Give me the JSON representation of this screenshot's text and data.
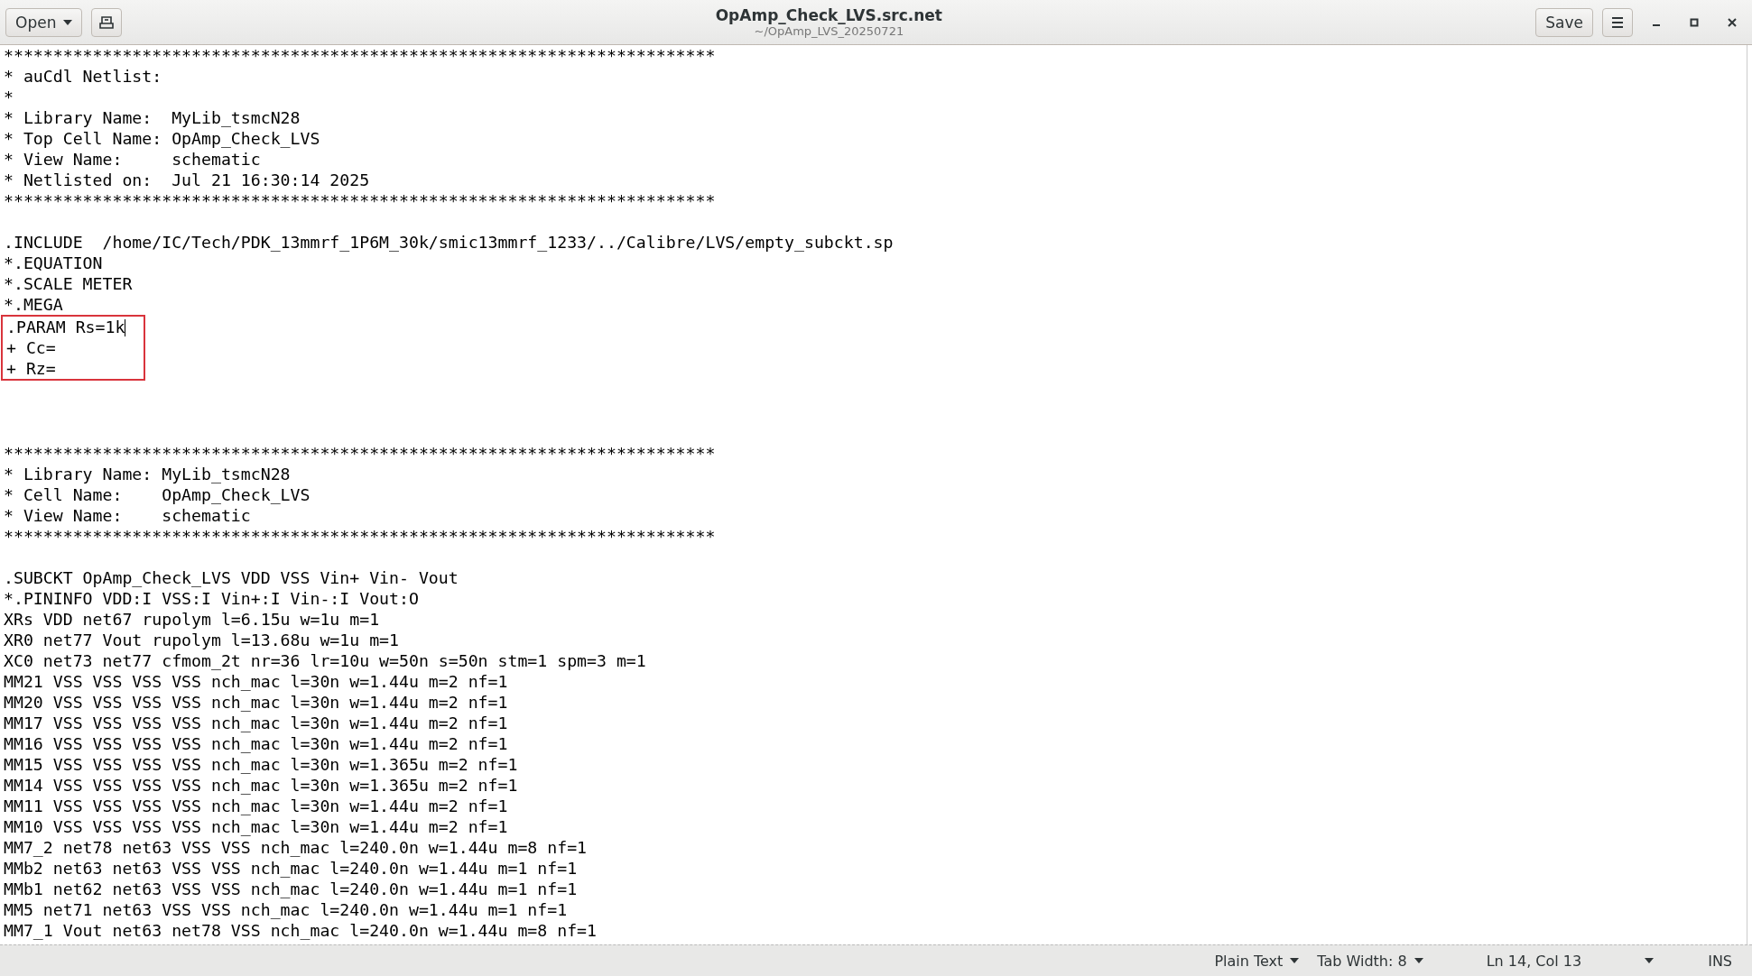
{
  "window": {
    "title": "OpAmp_Check_LVS.src.net",
    "subtitle": "~/OpAmp_LVS_20250721"
  },
  "header_bar": {
    "open_button": "Open",
    "save_button": "Save"
  },
  "editor": {
    "blocks": [
      {
        "kind": "plain",
        "lines": [
          {
            "kind": "code",
            "text": "************************************************************************"
          },
          {
            "kind": "code",
            "text": "* auCdl Netlist:"
          },
          {
            "kind": "code",
            "text": "*"
          },
          {
            "kind": "code",
            "text": "* Library Name:  MyLib_tsmcN28"
          },
          {
            "kind": "code",
            "text": "* Top Cell Name: OpAmp_Check_LVS"
          },
          {
            "kind": "code",
            "text": "* View Name:     schematic"
          },
          {
            "kind": "code",
            "text": "* Netlisted on:  Jul 21 16:30:14 2025"
          },
          {
            "kind": "code",
            "text": "************************************************************************"
          },
          {
            "kind": "blank"
          },
          {
            "kind": "code",
            "text": ".INCLUDE  /home/IC/Tech/PDK_13mmrf_1P6M_30k/smic13mmrf_1233/../Calibre/LVS/empty_subckt.sp"
          },
          {
            "kind": "code",
            "text": "*.EQUATION"
          },
          {
            "kind": "code",
            "text": "*.SCALE METER"
          },
          {
            "kind": "code",
            "text": "*.MEGA"
          }
        ]
      },
      {
        "kind": "marked",
        "lines": [
          {
            "kind": "code",
            "text": ".PARAM Rs=1k",
            "cursor": true
          },
          {
            "kind": "code",
            "text": "+ Cc=",
            "cursor": false
          },
          {
            "kind": "code",
            "text": "+ Rz=",
            "cursor": false
          }
        ]
      },
      {
        "kind": "plain",
        "lines": [
          {
            "kind": "blank"
          },
          {
            "kind": "blank"
          },
          {
            "kind": "blank"
          },
          {
            "kind": "code",
            "text": "************************************************************************"
          },
          {
            "kind": "code",
            "text": "* Library Name: MyLib_tsmcN28"
          },
          {
            "kind": "code",
            "text": "* Cell Name:    OpAmp_Check_LVS"
          },
          {
            "kind": "code",
            "text": "* View Name:    schematic"
          },
          {
            "kind": "code",
            "text": "************************************************************************"
          },
          {
            "kind": "blank"
          },
          {
            "kind": "code",
            "text": ".SUBCKT OpAmp_Check_LVS VDD VSS Vin+ Vin- Vout"
          },
          {
            "kind": "code",
            "text": "*.PININFO VDD:I VSS:I Vin+:I Vin-:I Vout:O"
          },
          {
            "kind": "code",
            "text": "XRs VDD net67 rupolym l=6.15u w=1u m=1"
          },
          {
            "kind": "code",
            "text": "XR0 net77 Vout rupolym l=13.68u w=1u m=1"
          },
          {
            "kind": "code",
            "text": "XC0 net73 net77 cfmom_2t nr=36 lr=10u w=50n s=50n stm=1 spm=3 m=1"
          },
          {
            "kind": "code",
            "text": "MM21 VSS VSS VSS VSS nch_mac l=30n w=1.44u m=2 nf=1"
          },
          {
            "kind": "code",
            "text": "MM20 VSS VSS VSS VSS nch_mac l=30n w=1.44u m=2 nf=1"
          },
          {
            "kind": "code",
            "text": "MM17 VSS VSS VSS VSS nch_mac l=30n w=1.44u m=2 nf=1"
          },
          {
            "kind": "code",
            "text": "MM16 VSS VSS VSS VSS nch_mac l=30n w=1.44u m=2 nf=1"
          },
          {
            "kind": "code",
            "text": "MM15 VSS VSS VSS VSS nch_mac l=30n w=1.365u m=2 nf=1"
          },
          {
            "kind": "code",
            "text": "MM14 VSS VSS VSS VSS nch_mac l=30n w=1.365u m=2 nf=1"
          },
          {
            "kind": "code",
            "text": "MM11 VSS VSS VSS VSS nch_mac l=30n w=1.44u m=2 nf=1"
          },
          {
            "kind": "code",
            "text": "MM10 VSS VSS VSS VSS nch_mac l=30n w=1.44u m=2 nf=1"
          },
          {
            "kind": "code",
            "text": "MM7_2 net78 net63 VSS VSS nch_mac l=240.0n w=1.44u m=8 nf=1"
          },
          {
            "kind": "code",
            "text": "MMb2 net63 net63 VSS VSS nch_mac l=240.0n w=1.44u m=1 nf=1"
          },
          {
            "kind": "code",
            "text": "MMb1 net62 net63 VSS VSS nch_mac l=240.0n w=1.44u m=1 nf=1"
          },
          {
            "kind": "code",
            "text": "MM5 net71 net63 VSS VSS nch_mac l=240.0n w=1.44u m=1 nf=1"
          },
          {
            "kind": "code",
            "text": "MM7_1 Vout net63 net78 VSS nch_mac l=240.0n w=1.44u m=8 nf=1"
          }
        ]
      }
    ]
  },
  "status_bar": {
    "language": "Plain Text",
    "tab_width": "Tab Width: 8",
    "position": "Ln 14, Col 13",
    "mode": "INS"
  }
}
